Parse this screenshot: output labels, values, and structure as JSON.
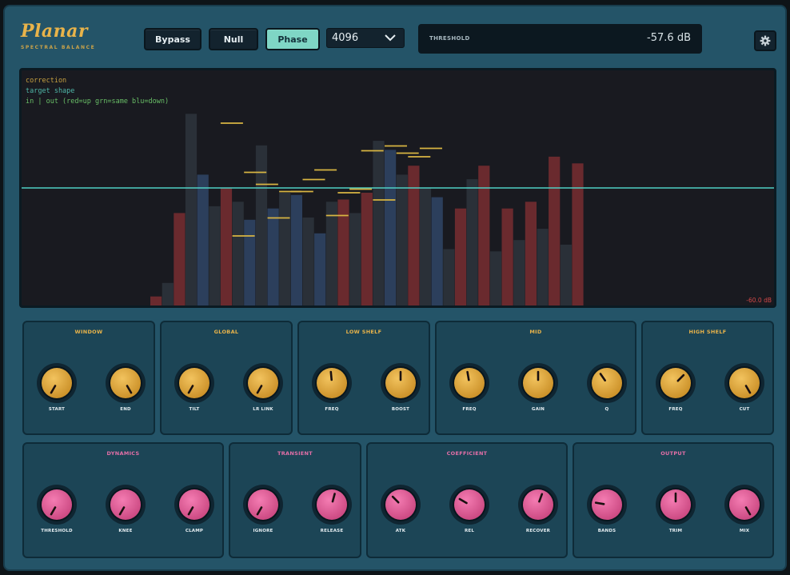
{
  "header": {
    "title": "Planar",
    "subtitle": "SPECTRAL BALANCE",
    "buttons": [
      {
        "label": "Bypass",
        "active": false
      },
      {
        "label": "Null",
        "active": false
      },
      {
        "label": "Phase",
        "active": true
      }
    ],
    "fft_size": "4096",
    "threshold_label": "THRESHOLD",
    "threshold_value": "-57.6 dB"
  },
  "spectrum": {
    "legend": [
      "correction",
      "target shape",
      "in | out  (red=up  grn=same  blu=down)"
    ],
    "floor_label": "-60.0 dB",
    "colors": {
      "correction": "#d8b542",
      "target": "#4fd0c4",
      "up": "#6a2a2e",
      "same": "#2a3038",
      "down": "#2c3f5c"
    },
    "bars": [
      {
        "kind": "up",
        "level": 0.04
      },
      {
        "kind": "same",
        "level": 0.1
      },
      {
        "kind": "up",
        "level": 0.41
      },
      {
        "kind": "same",
        "level": 0.85
      },
      {
        "kind": "down",
        "level": 0.58
      },
      {
        "kind": "same",
        "level": 0.44
      },
      {
        "kind": "up",
        "level": 0.52
      },
      {
        "kind": "same",
        "level": 0.46
      },
      {
        "kind": "down",
        "level": 0.38
      },
      {
        "kind": "same",
        "level": 0.71
      },
      {
        "kind": "down",
        "level": 0.43
      },
      {
        "kind": "same",
        "level": 0.5
      },
      {
        "kind": "down",
        "level": 0.49
      },
      {
        "kind": "same",
        "level": 0.39
      },
      {
        "kind": "down",
        "level": 0.32
      },
      {
        "kind": "same",
        "level": 0.46
      },
      {
        "kind": "up",
        "level": 0.47
      },
      {
        "kind": "same",
        "level": 0.41
      },
      {
        "kind": "up",
        "level": 0.5
      },
      {
        "kind": "same",
        "level": 0.73
      },
      {
        "kind": "down",
        "level": 0.69
      },
      {
        "kind": "same",
        "level": 0.58
      },
      {
        "kind": "up",
        "level": 0.62
      },
      {
        "kind": "same",
        "level": 0.52
      },
      {
        "kind": "down",
        "level": 0.48
      },
      {
        "kind": "same",
        "level": 0.25
      },
      {
        "kind": "up",
        "level": 0.43
      },
      {
        "kind": "same",
        "level": 0.56
      },
      {
        "kind": "up",
        "level": 0.62
      },
      {
        "kind": "same",
        "level": 0.24
      },
      {
        "kind": "up",
        "level": 0.43
      },
      {
        "kind": "same",
        "level": 0.29
      },
      {
        "kind": "up",
        "level": 0.46
      },
      {
        "kind": "same",
        "level": 0.34
      },
      {
        "kind": "up",
        "level": 0.66
      },
      {
        "kind": "same",
        "level": 0.27
      },
      {
        "kind": "up",
        "level": 0.63
      }
    ],
    "correction": [
      {
        "band": 6,
        "level": 0.54
      },
      {
        "band": 7,
        "level": -0.4
      },
      {
        "band": 8,
        "level": 0.13
      },
      {
        "band": 9,
        "level": 0.03
      },
      {
        "band": 10,
        "level": -0.25
      },
      {
        "band": 11,
        "level": -0.03
      },
      {
        "band": 12,
        "level": -0.03
      },
      {
        "band": 13,
        "level": 0.07
      },
      {
        "band": 14,
        "level": 0.15
      },
      {
        "band": 15,
        "level": -0.23
      },
      {
        "band": 16,
        "level": -0.04
      },
      {
        "band": 17,
        "level": -0.01
      },
      {
        "band": 18,
        "level": 0.31
      },
      {
        "band": 19,
        "level": -0.1
      },
      {
        "band": 20,
        "level": 0.35
      },
      {
        "band": 21,
        "level": 0.29
      },
      {
        "band": 22,
        "level": 0.26
      },
      {
        "band": 23,
        "level": 0.33
      }
    ]
  },
  "panels": [
    {
      "title": "WINDOW",
      "color": "gold",
      "knobs": [
        {
          "label": "START",
          "angle": -150
        },
        {
          "label": "END",
          "angle": 150
        }
      ]
    },
    {
      "title": "GLOBAL",
      "color": "gold",
      "knobs": [
        {
          "label": "TILT",
          "angle": -150
        },
        {
          "label": "LR LINK",
          "angle": -150
        }
      ]
    },
    {
      "title": "LOW SHELF",
      "color": "gold",
      "knobs": [
        {
          "label": "FREQ",
          "angle": -5
        },
        {
          "label": "BOOST",
          "angle": 0
        }
      ]
    },
    {
      "title": "MID",
      "color": "gold",
      "knobs": [
        {
          "label": "FREQ",
          "angle": -10
        },
        {
          "label": "GAIN",
          "angle": 0
        },
        {
          "label": "Q",
          "angle": -35
        }
      ]
    },
    {
      "title": "HIGH SHELF",
      "color": "gold",
      "knobs": [
        {
          "label": "FREQ",
          "angle": 45
        },
        {
          "label": "CUT",
          "angle": 150
        }
      ]
    },
    {
      "title": "DYNAMICS",
      "color": "pink",
      "knobs": [
        {
          "label": "THRESHOLD",
          "angle": -150
        },
        {
          "label": "KNEE",
          "angle": -150
        },
        {
          "label": "CLAMP",
          "angle": -150
        }
      ]
    },
    {
      "title": "TRANSIENT",
      "color": "pink",
      "knobs": [
        {
          "label": "IGNORE",
          "angle": -150
        },
        {
          "label": "RELEASE",
          "angle": 15
        }
      ]
    },
    {
      "title": "COEFFICIENT",
      "color": "pink",
      "knobs": [
        {
          "label": "ATK",
          "angle": -45
        },
        {
          "label": "REL",
          "angle": -60
        },
        {
          "label": "RECOVER",
          "angle": 20
        }
      ]
    },
    {
      "title": "OUTPUT",
      "color": "pink",
      "knobs": [
        {
          "label": "BANDS",
          "angle": -80
        },
        {
          "label": "TRIM",
          "angle": 0
        },
        {
          "label": "MIX",
          "angle": 150
        }
      ]
    }
  ]
}
